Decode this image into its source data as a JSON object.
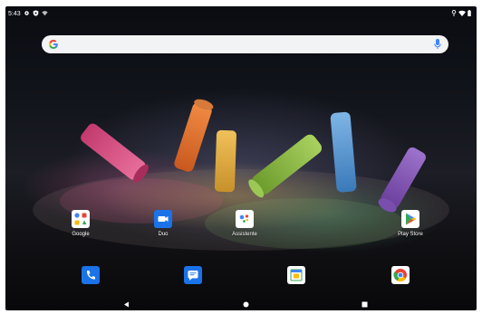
{
  "status_bar": {
    "time": "5:43",
    "left_icons": [
      "settings-gear-icon",
      "shield-icon",
      "wifi-icon"
    ],
    "right_icons": [
      "vpn-key-icon",
      "wifi-icon",
      "battery-icon"
    ]
  },
  "search_bar": {
    "logo": "google-g-icon",
    "mic": "microphone-icon"
  },
  "apps": [
    {
      "label": "Google",
      "icon": "google-folder-icon"
    },
    {
      "label": "Duo",
      "icon": "duo-video-icon"
    },
    {
      "label": "Assistente",
      "icon": "assistant-icon"
    },
    {
      "label": "Play Store",
      "icon": "play-store-icon"
    }
  ],
  "dock": [
    {
      "icon": "phone-icon"
    },
    {
      "icon": "messages-icon"
    },
    {
      "icon": "calendar-icon"
    },
    {
      "icon": "chrome-icon"
    }
  ],
  "nav": {
    "back": "back-icon",
    "home": "home-icon",
    "recents": "recents-icon"
  },
  "colors": {
    "accent_blue": "#1a73e8",
    "search_bg": "#f1f3f4"
  }
}
